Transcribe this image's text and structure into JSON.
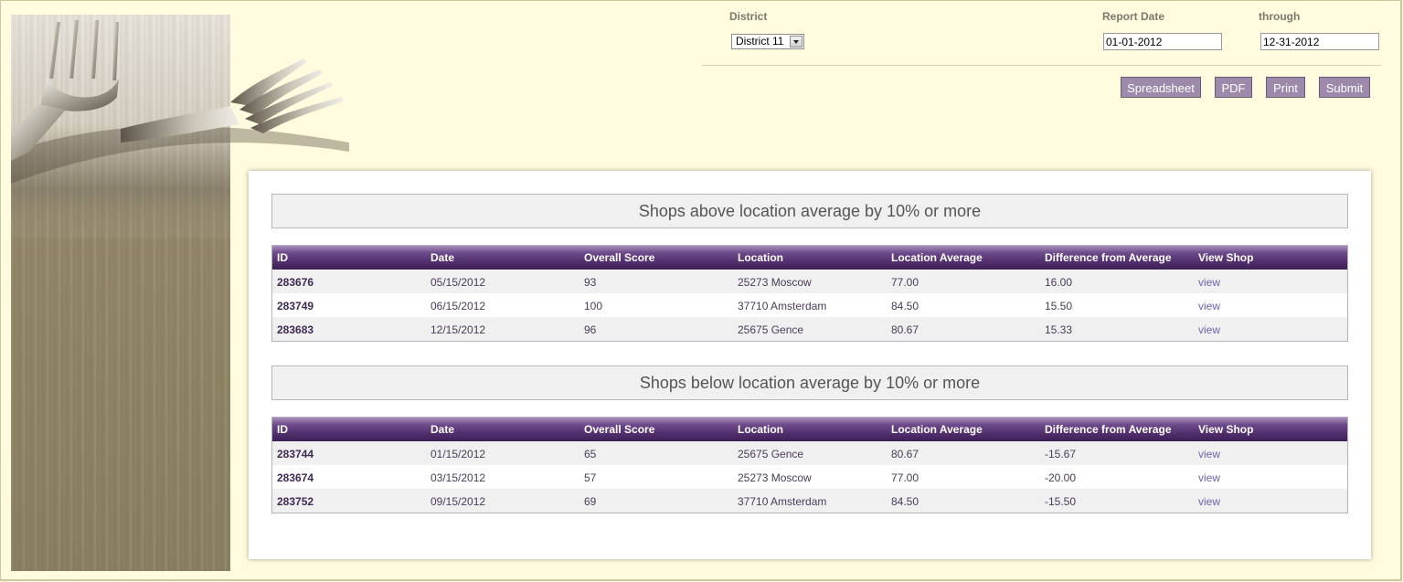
{
  "filters": {
    "district_label": "District",
    "district_value": "District 11",
    "report_date_label": "Report Date",
    "report_date_value": "01-01-2012",
    "through_label": "through",
    "through_value": "12-31-2012"
  },
  "buttons": {
    "spreadsheet": "Spreadsheet",
    "pdf": "PDF",
    "print": "Print",
    "submit": "Submit"
  },
  "columns": [
    "ID",
    "Date",
    "Overall Score",
    "Location",
    "Location Average",
    "Difference from Average",
    "View Shop"
  ],
  "above": {
    "title": "Shops above location average by 10% or more",
    "rows": [
      {
        "id": "283676",
        "date": "05/15/2012",
        "score": "93",
        "location": "25273 Moscow",
        "avg": "77.00",
        "diff": "16.00",
        "view": "view"
      },
      {
        "id": "283749",
        "date": "06/15/2012",
        "score": "100",
        "location": "37710 Amsterdam",
        "avg": "84.50",
        "diff": "15.50",
        "view": "view"
      },
      {
        "id": "283683",
        "date": "12/15/2012",
        "score": "96",
        "location": "25675 Gence",
        "avg": "80.67",
        "diff": "15.33",
        "view": "view"
      }
    ]
  },
  "below": {
    "title": "Shops below location average by 10% or more",
    "rows": [
      {
        "id": "283744",
        "date": "01/15/2012",
        "score": "65",
        "location": "25675 Gence",
        "avg": "80.67",
        "diff": "-15.67",
        "view": "view"
      },
      {
        "id": "283674",
        "date": "03/15/2012",
        "score": "57",
        "location": "25273 Moscow",
        "avg": "77.00",
        "diff": "-20.00",
        "view": "view"
      },
      {
        "id": "283752",
        "date": "09/15/2012",
        "score": "69",
        "location": "37710 Amsterdam",
        "avg": "84.50",
        "diff": "-15.50",
        "view": "view"
      }
    ]
  },
  "colors": {
    "page_bg": "#fffbdf",
    "header_purple": "#53306f",
    "button_purple": "#9d8aab",
    "link": "#7162b0"
  },
  "icons": {
    "banner": "forks-banner-icon",
    "dropdown": "chevron-down-icon"
  }
}
